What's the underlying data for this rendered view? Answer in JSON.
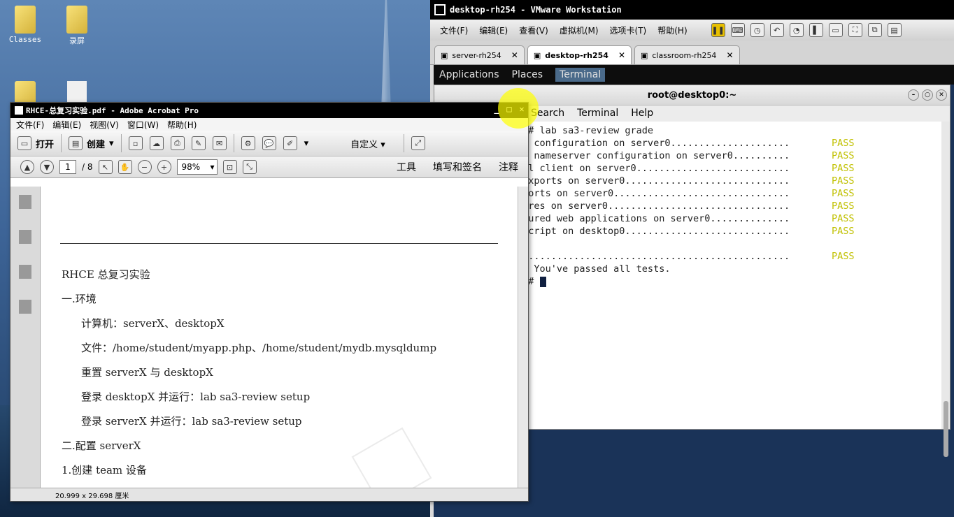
{
  "desktop": {
    "icons": [
      {
        "label": "Classes"
      },
      {
        "label": "录屏"
      }
    ]
  },
  "vmware": {
    "title": "desktop-rh254 - VMware Workstation",
    "menu": [
      "文件(F)",
      "编辑(E)",
      "查看(V)",
      "虚拟机(M)",
      "选项卡(T)",
      "帮助(H)"
    ],
    "tabs": [
      {
        "label": "server-rh254"
      },
      {
        "label": "desktop-rh254"
      },
      {
        "label": "classroom-rh254"
      }
    ],
    "gnome": {
      "applications": "Applications",
      "places": "Places",
      "terminal": "Terminal"
    },
    "terminal": {
      "title": "root@desktop0:~",
      "menu": [
        "Search",
        "Terminal",
        "Help"
      ],
      "lines": [
        {
          "text": "~]# lab sa3-review grade",
          "status": ""
        },
        {
          "text": "ng configuration on server0.....................",
          "status": "PASS"
        },
        {
          "text": "ng nameserver configuration on server0..........",
          "status": "PASS"
        },
        {
          "text": "ull client on server0...........................",
          "status": "PASS"
        },
        {
          "text": " exports on server0.............................",
          "status": "PASS"
        },
        {
          "text": "xports on server0...............................",
          "status": "PASS"
        },
        {
          "text": "hares on server0................................",
          "status": "PASS"
        },
        {
          "text": "ecured web applications on server0..............",
          "status": "PASS"
        },
        {
          "text": " script on desktop0.............................",
          "status": "PASS"
        },
        {
          "text": "",
          "status": ""
        },
        {
          "text": "................................................",
          "status": "PASS"
        },
        {
          "text": "s! You've passed all tests.",
          "status": ""
        },
        {
          "text": "~]# ",
          "status": ""
        }
      ]
    }
  },
  "acrobat": {
    "title": "RHCE-总复习实验.pdf - Adobe Acrobat Pro",
    "menu": [
      "文件(F)",
      "编辑(E)",
      "视图(V)",
      "窗口(W)",
      "帮助(H)"
    ],
    "toolbar": {
      "open": "打开",
      "create": "创建",
      "customize": "自定义"
    },
    "nav": {
      "page": "1",
      "total": "/ 8",
      "zoom": "98%"
    },
    "right_tools": [
      "工具",
      "填写和签名",
      "注释"
    ],
    "status": "20.999 x 29.698 厘米",
    "doc_lines": [
      "RHCE 总复习实验",
      "一.环境",
      "计算机：serverX、desktopX",
      "文件：/home/student/myapp.php、/home/student/mydb.mysqldump",
      "重置 serverX 与 desktopX",
      "登录 desktopX 并运行：lab sa3-review setup",
      "登录 serverX 并运行：lab sa3-review setup",
      "二.配置 serverX",
      "1.创建 team 设备"
    ]
  }
}
